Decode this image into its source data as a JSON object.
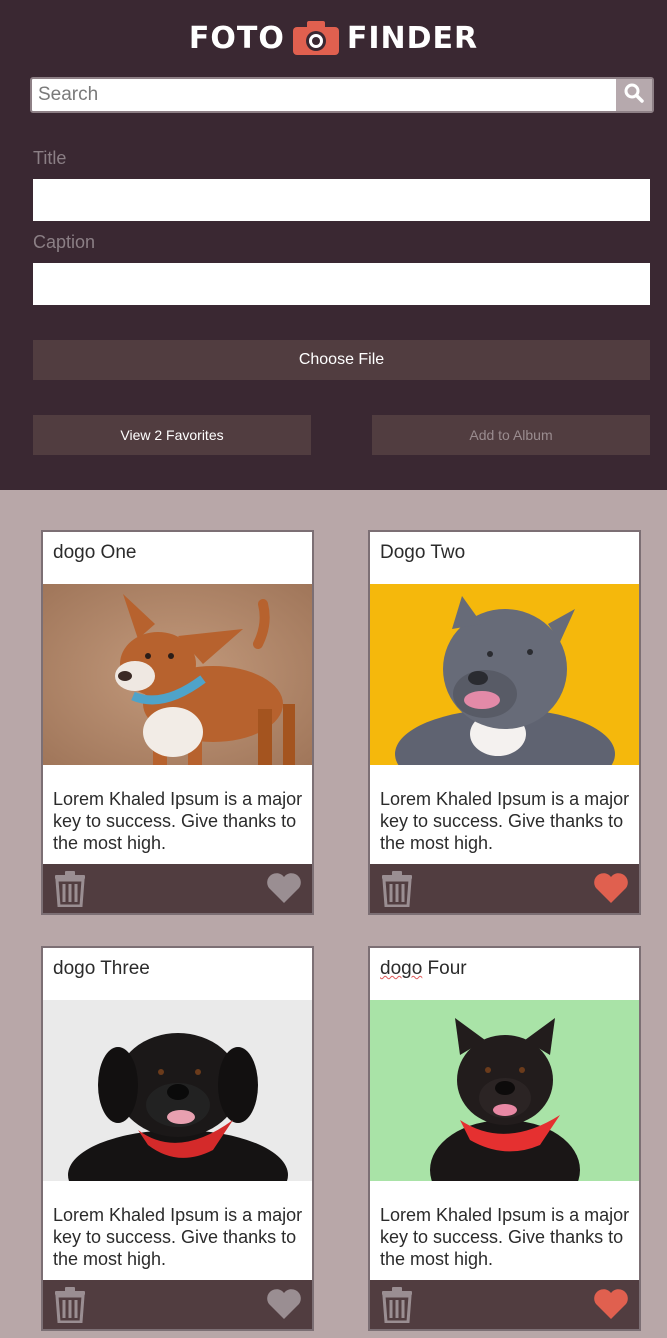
{
  "header": {
    "logo_left": "FOTO",
    "logo_right": "FINDER",
    "logo_icon": "camera-icon"
  },
  "search": {
    "placeholder": "Search",
    "icon": "search-icon"
  },
  "form": {
    "title_label": "Title",
    "caption_label": "Caption",
    "choose_file_label": "Choose File",
    "view_favorites_label": "View 2 Favorites",
    "add_album_label": "Add to Album"
  },
  "cards": [
    {
      "title": "dogo One",
      "caption": "Lorem Khaled Ipsum is a major key to success. Give thanks to the most high.",
      "favorited": false
    },
    {
      "title": "Dogo Two",
      "caption": "Lorem Khaled Ipsum is a major key to success. Give thanks to the most high.",
      "favorited": true
    },
    {
      "title_a": "dogo",
      "title_b": " Four",
      "title": "dogo Three",
      "caption": "Lorem Khaled Ipsum is a major key to success. Give thanks to the most high.",
      "favorited": false
    },
    {
      "title_a": "dogo",
      "title_b": " Four",
      "caption": "Lorem Khaled Ipsum is a major key to success. Give thanks to the most high.",
      "favorited": true
    }
  ],
  "colors": {
    "header_bg": "#3a2832",
    "page_bg": "#b8a7a8",
    "button_bg": "#513d40",
    "favorite_active": "#e0604f",
    "favorite_inactive": "#9a8e92",
    "logo_accent": "#e0604f"
  }
}
